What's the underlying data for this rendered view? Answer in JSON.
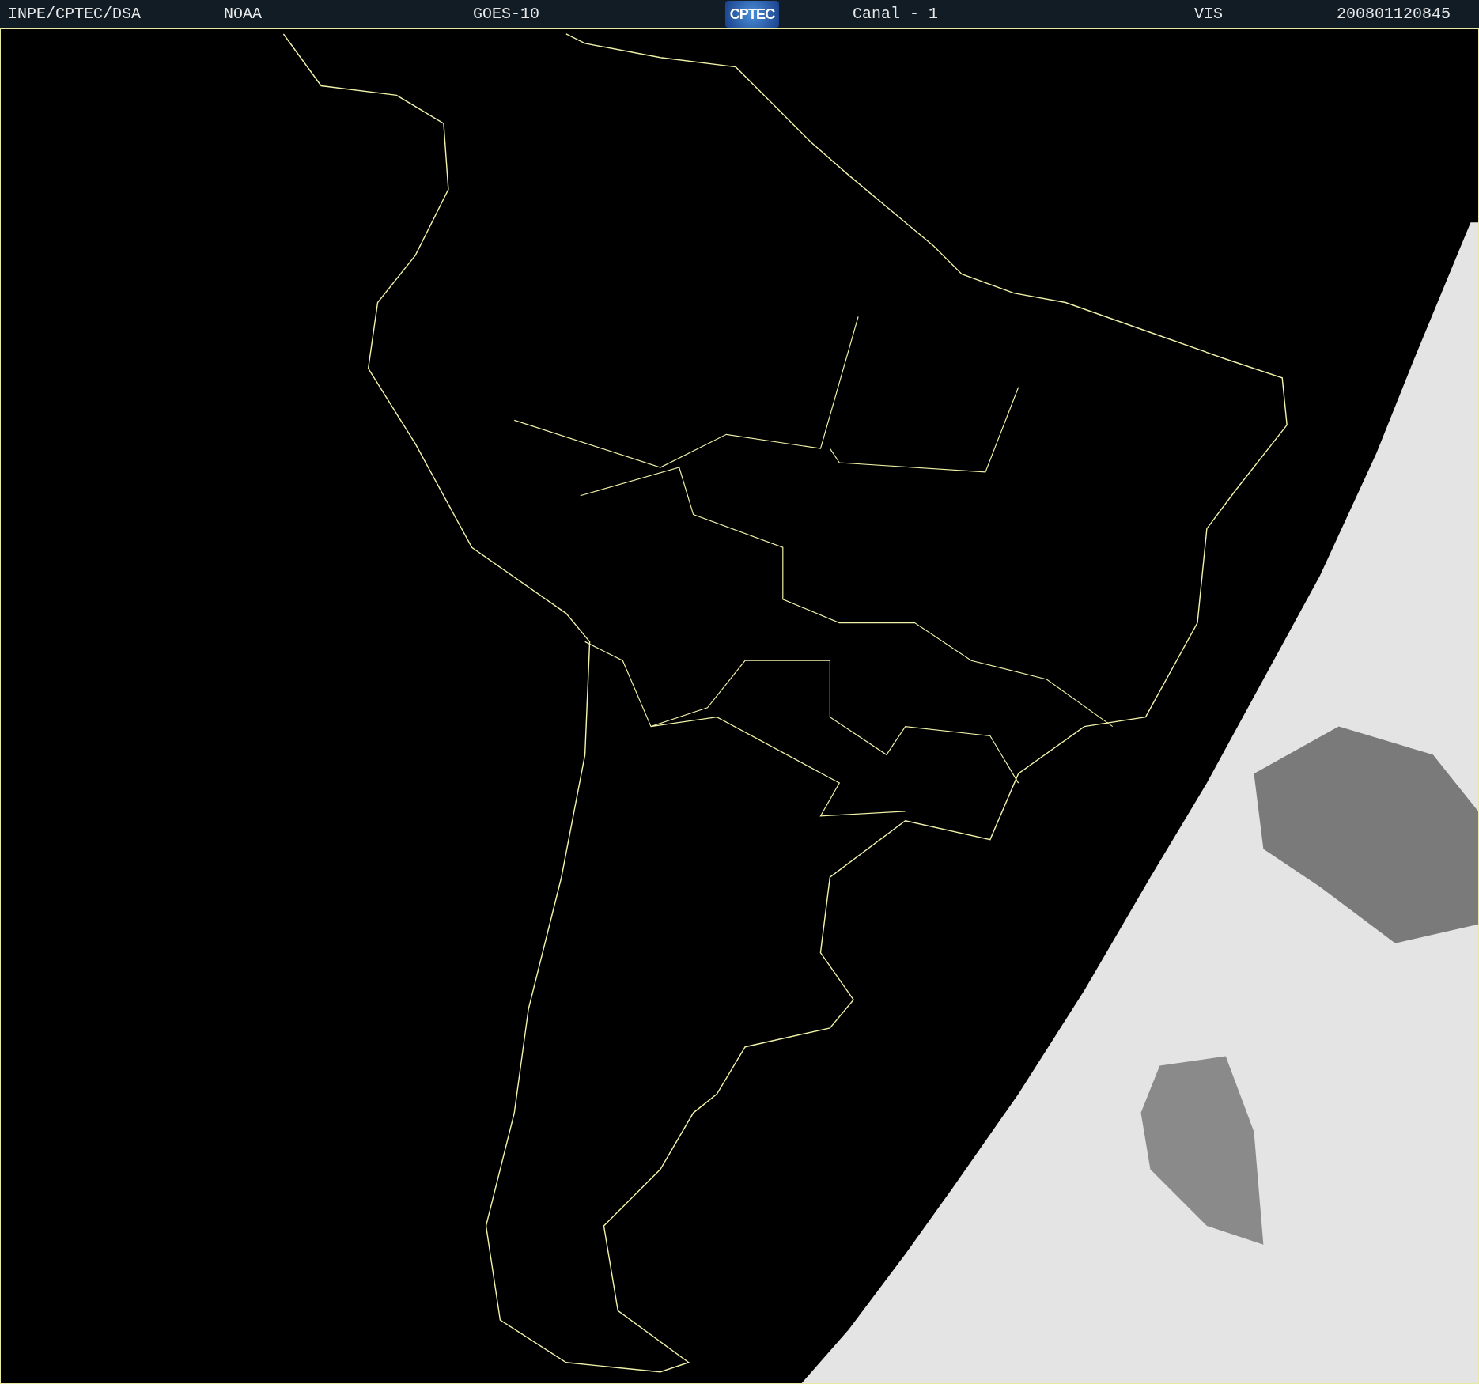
{
  "header": {
    "items": [
      {
        "kind": "text",
        "text": "INPE/CPTEC/DSA"
      },
      {
        "kind": "text",
        "text": "NOAA"
      },
      {
        "kind": "text",
        "text": "GOES-10"
      },
      {
        "kind": "logo",
        "text": "CPTEC"
      },
      {
        "kind": "text",
        "text": "Canal - 1"
      },
      {
        "kind": "text",
        "text": "VIS"
      },
      {
        "kind": "text",
        "text": "200801120845"
      }
    ]
  }
}
